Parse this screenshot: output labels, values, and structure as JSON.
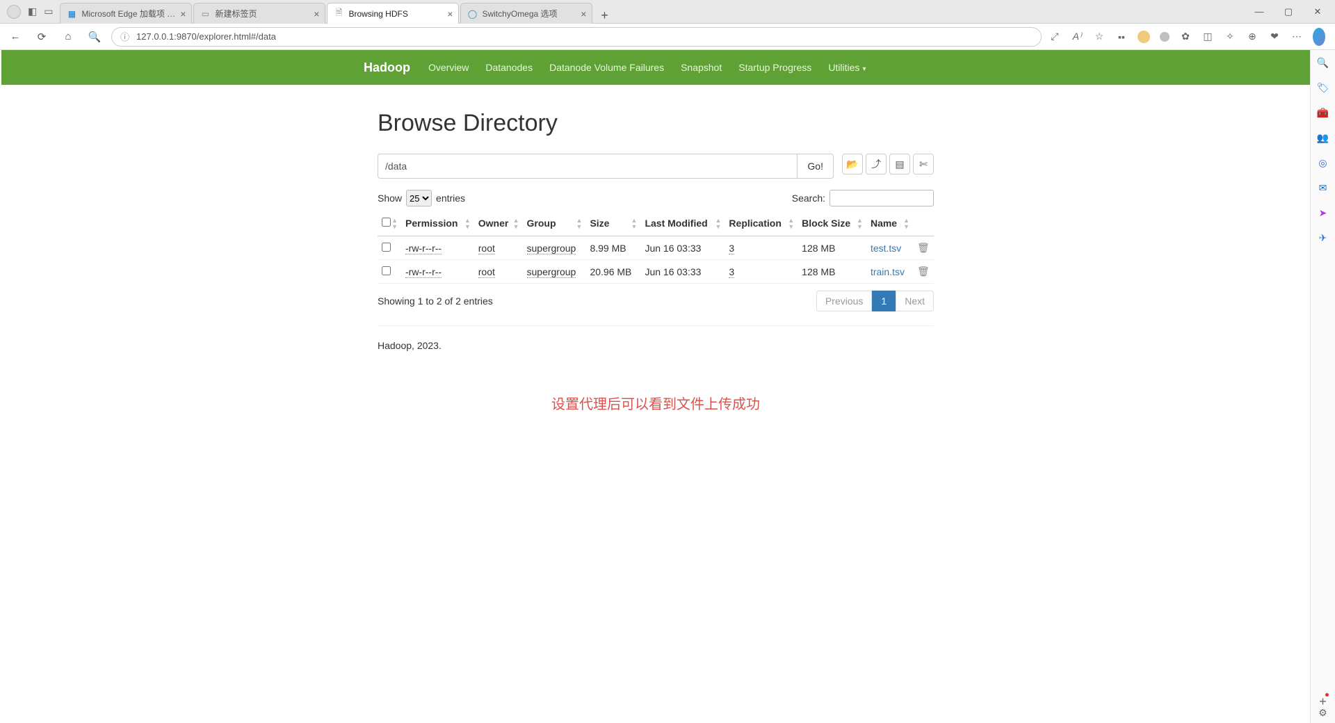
{
  "browser": {
    "tabs": [
      {
        "title": "Microsoft Edge 加载项 - Switchy",
        "favicon_color": "#0078d4"
      },
      {
        "title": "新建标签页",
        "favicon_color": "#888"
      },
      {
        "title": "Browsing HDFS",
        "favicon_color": "#888"
      },
      {
        "title": "SwitchyOmega 选项",
        "favicon_color": "#1e90c8"
      }
    ],
    "active_tab_index": 2,
    "url_display": "127.0.0.1:9870/explorer.html#/data"
  },
  "nav": {
    "brand": "Hadoop",
    "links": [
      "Overview",
      "Datanodes",
      "Datanode Volume Failures",
      "Snapshot",
      "Startup Progress"
    ],
    "dropdown_label": "Utilities"
  },
  "page": {
    "title": "Browse Directory",
    "path_value": "/data",
    "go_label": "Go!",
    "show_prefix": "Show",
    "show_value": "25",
    "show_suffix": "entries",
    "search_label": "Search:",
    "columns": [
      "Permission",
      "Owner",
      "Group",
      "Size",
      "Last Modified",
      "Replication",
      "Block Size",
      "Name"
    ],
    "rows": [
      {
        "permission": "-rw-r--r--",
        "owner": "root",
        "group": "supergroup",
        "size": "8.99 MB",
        "modified": "Jun 16 03:33",
        "replication": "3",
        "block": "128 MB",
        "name": "test.tsv"
      },
      {
        "permission": "-rw-r--r--",
        "owner": "root",
        "group": "supergroup",
        "size": "20.96 MB",
        "modified": "Jun 16 03:33",
        "replication": "3",
        "block": "128 MB",
        "name": "train.tsv"
      }
    ],
    "info_text": "Showing 1 to 2 of 2 entries",
    "pager_prev": "Previous",
    "pager_page": "1",
    "pager_next": "Next",
    "footer": "Hadoop, 2023.",
    "annotation": "设置代理后可以看到文件上传成功"
  }
}
